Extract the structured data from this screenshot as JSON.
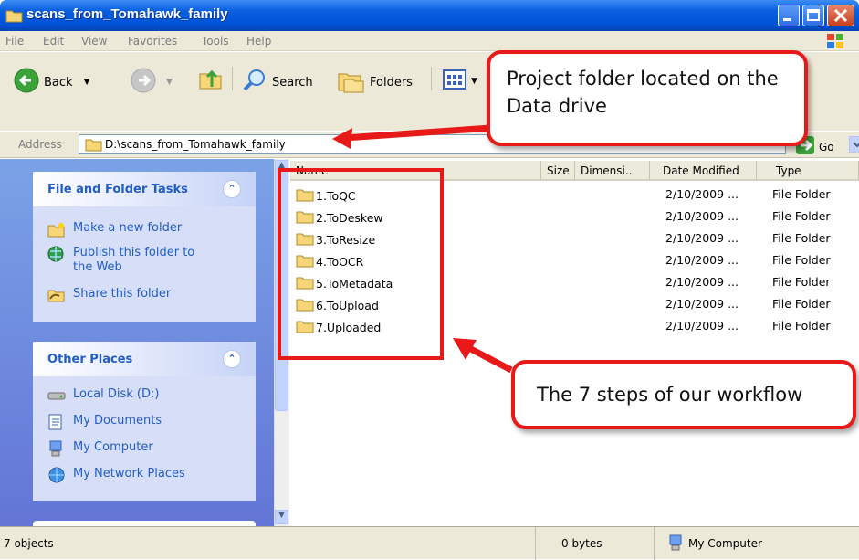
{
  "window": {
    "title": "scans_from_Tomahawk_family"
  },
  "menu": [
    "File",
    "Edit",
    "View",
    "Favorites",
    "Tools",
    "Help"
  ],
  "toolbar": {
    "back": "Back",
    "search": "Search",
    "folders": "Folders"
  },
  "address": {
    "label": "Address",
    "path": "D:\\scans_from_Tomahawk_family",
    "go": "Go"
  },
  "tasks": {
    "file_folder": {
      "title": "File and Folder Tasks",
      "items": [
        "Make a new folder",
        "Publish this folder to the Web",
        "Share this folder"
      ]
    },
    "other_places": {
      "title": "Other Places",
      "items": [
        "Local Disk (D:)",
        "My Documents",
        "My Computer",
        "My Network Places"
      ]
    }
  },
  "columns": [
    "Name",
    "Size",
    "Dimensi...",
    "Date Modified",
    "Type"
  ],
  "files": [
    {
      "name": "1.ToQC",
      "date": "2/10/2009 ...",
      "type": "File Folder"
    },
    {
      "name": "2.ToDeskew",
      "date": "2/10/2009 ...",
      "type": "File Folder"
    },
    {
      "name": "3.ToResize",
      "date": "2/10/2009 ...",
      "type": "File Folder"
    },
    {
      "name": "4.ToOCR",
      "date": "2/10/2009 ...",
      "type": "File Folder"
    },
    {
      "name": "5.ToMetadata",
      "date": "2/10/2009 ...",
      "type": "File Folder"
    },
    {
      "name": "6.ToUpload",
      "date": "2/10/2009 ...",
      "type": "File Folder"
    },
    {
      "name": "7.Uploaded",
      "date": "2/10/2009 ...",
      "type": "File Folder"
    }
  ],
  "status": {
    "objects": "7 objects",
    "size": "0 bytes",
    "location": "My Computer"
  },
  "callouts": {
    "project": "Project folder located on the Data drive",
    "workflow": "The 7 steps of our workflow"
  },
  "colors": {
    "accent": "#e81919",
    "xp_blue": "#0053d8",
    "task_link": "#215dc6"
  }
}
